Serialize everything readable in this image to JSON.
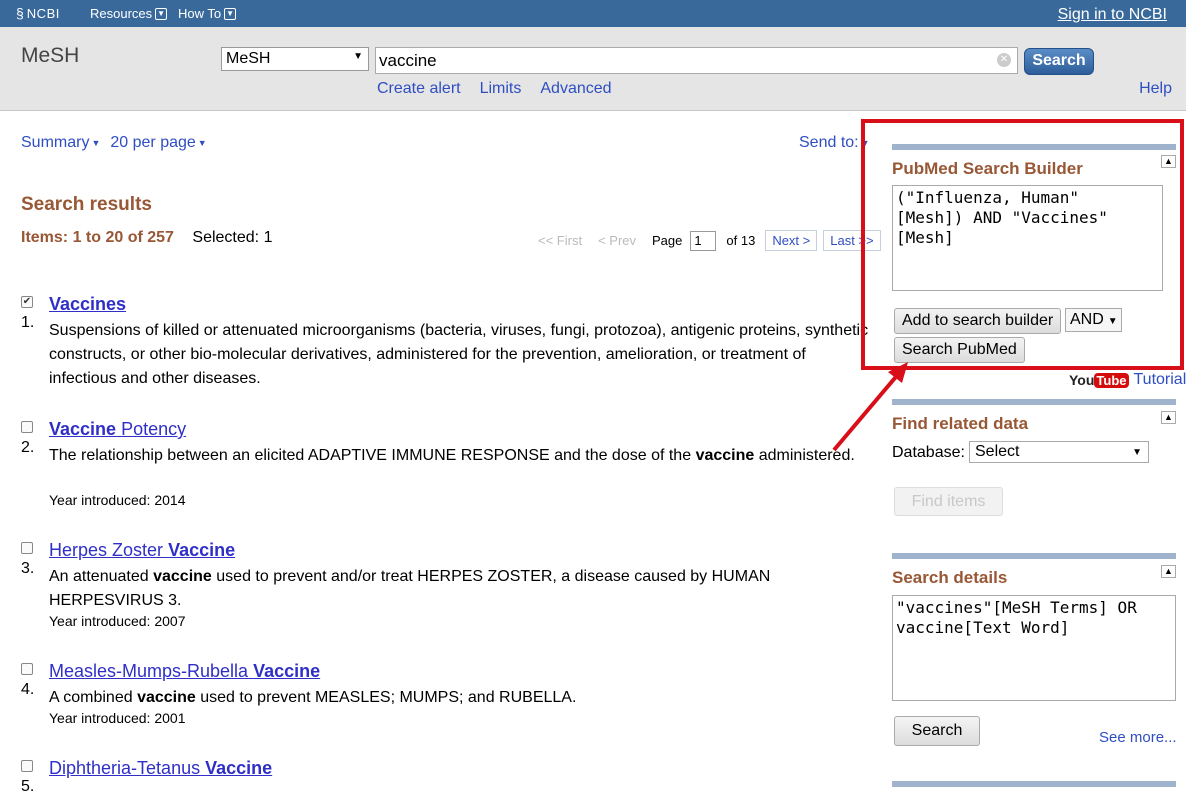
{
  "ncbi_bar": {
    "logo_text": "NCBI",
    "resources_label": "Resources",
    "howto_label": "How To",
    "signin_label": "Sign in to NCBI"
  },
  "search_header": {
    "db_title": "MeSH",
    "db_select_value": "MeSH",
    "search_term": "vaccine",
    "search_button": "Search",
    "links": [
      "Create alert",
      "Limits",
      "Advanced"
    ],
    "help_label": "Help"
  },
  "toolbar": {
    "format": "Summary",
    "per_page": "20 per page",
    "send_to": "Send to:"
  },
  "results": {
    "heading": "Search results",
    "items_range": "Items: 1 to 20 of 257",
    "selected": "Selected: 1",
    "pager": {
      "first": "<< First",
      "prev": "< Prev",
      "page_label": "Page",
      "page_value": "1",
      "of_label": "of 13",
      "next": "Next >",
      "last": "Last >>"
    },
    "items": [
      {
        "num": "1.",
        "checked": true,
        "title_plain": "",
        "title_bold": "Vaccines",
        "desc": "Suspensions of killed or attenuated microorganisms (bacteria, viruses, fungi, protozoa), antigenic proteins, synthetic constructs, or other bio-molecular derivatives, administered for the prevention, amelioration, or treatment of infectious and other diseases.",
        "year": ""
      },
      {
        "num": "2.",
        "checked": false,
        "title_bold": "Vaccine",
        "title_plain": "Potency",
        "desc_before": "The relationship between an elicited ADAPTIVE IMMUNE RESPONSE and the dose of the",
        "desc_bold": "vaccine",
        "desc_after": "administered.",
        "year": "Year introduced: 2014"
      },
      {
        "num": "3.",
        "checked": false,
        "title_plain": "Herpes Zoster",
        "title_bold": "Vaccine",
        "desc_before": "An attenuated",
        "desc_bold": "vaccine",
        "desc_after": "used to prevent and/or treat HERPES ZOSTER, a disease caused by HUMAN HERPESVIRUS 3.",
        "year": "Year introduced: 2007"
      },
      {
        "num": "4.",
        "checked": false,
        "title_plain": "Measles-Mumps-Rubella",
        "title_bold": "Vaccine",
        "desc_before": "A combined",
        "desc_bold": "vaccine",
        "desc_after": "used to prevent MEASLES; MUMPS; and RUBELLA.",
        "year": "Year introduced: 2001"
      },
      {
        "num": "5.",
        "checked": false,
        "title_plain": "Diphtheria-Tetanus",
        "title_bold": "Vaccine",
        "desc": "",
        "year": ""
      }
    ]
  },
  "sidebar": {
    "builder": {
      "heading": "PubMed Search Builder",
      "query": "(\"Influenza, Human\"\n[Mesh]) AND \"Vaccines\"\n[Mesh]",
      "add_button": "Add to search builder",
      "operator": "AND",
      "search_button": "Search PubMed"
    },
    "tutorial": {
      "you": "You",
      "tube": "Tube",
      "label": "Tutorial"
    },
    "related": {
      "heading": "Find related data",
      "db_label": "Database:",
      "db_value": "Select",
      "find_button": "Find items"
    },
    "details": {
      "heading": "Search details",
      "query": "\"vaccines\"[MeSH Terms] OR\nvaccine[Text Word]",
      "search_button": "Search",
      "see_more": "See more..."
    }
  },
  "colors": {
    "ncbi_blue": "#39699b",
    "heading_brown": "#985735",
    "link_blue": "#2f4ec2",
    "highlight_red": "#d80e18"
  }
}
